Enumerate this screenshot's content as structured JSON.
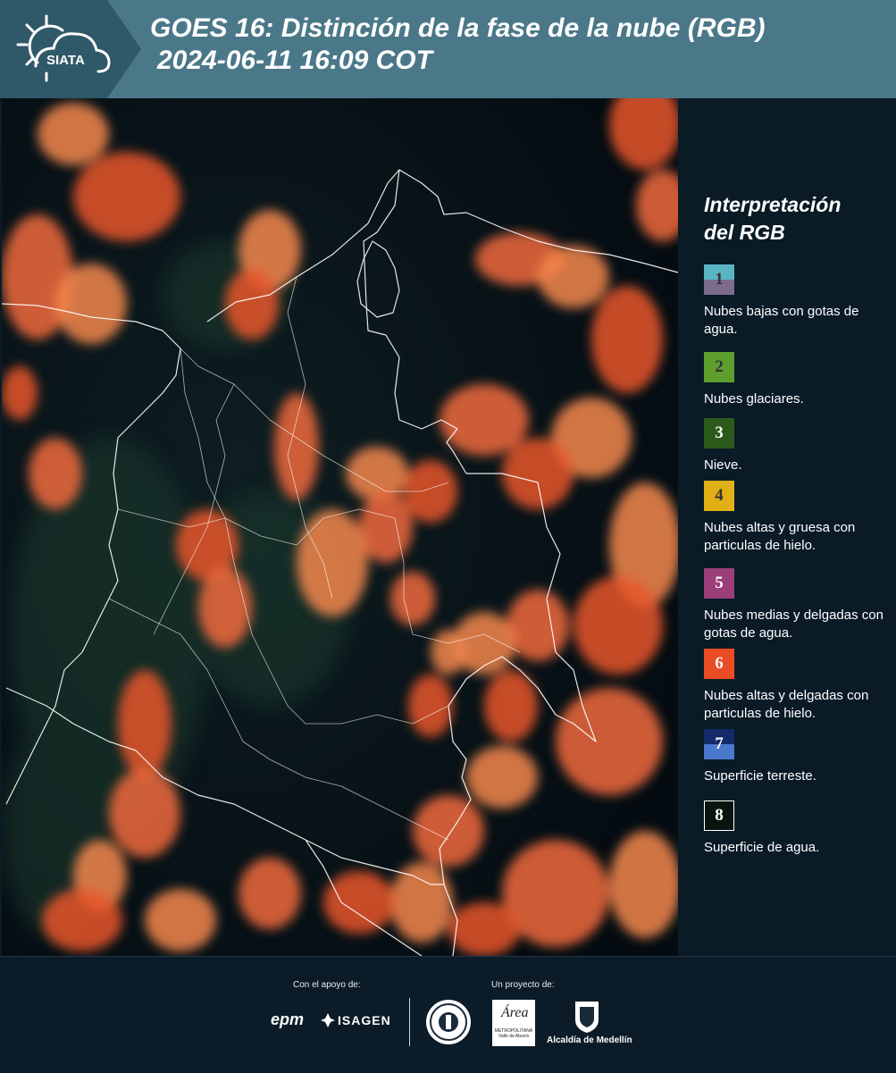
{
  "header": {
    "logo_text": "SIATA",
    "title_line1": "GOES 16: Distinción de la fase de la nube (RGB)",
    "title_line2": "2024-06-11 16:09 COT"
  },
  "legend": {
    "title_line1": "Interpretación",
    "title_line2": "del RGB",
    "items": [
      {
        "number": "1",
        "label": "Nubes bajas con gotas de agua.",
        "color_top": "#5ab4c4",
        "color_bottom": "#7c6c8c"
      },
      {
        "number": "2",
        "label": "Nubes glaciares.",
        "color_top": "#5e9e2c",
        "color_bottom": "#5e9e2c"
      },
      {
        "number": "3",
        "label": "Nieve.",
        "color_top": "#2c5a1a",
        "color_bottom": "#2c5a1a"
      },
      {
        "number": "4",
        "label": "Nubes altas y gruesa con particulas de hielo.",
        "color_top": "#e0b016",
        "color_bottom": "#e0b016"
      },
      {
        "number": "5",
        "label": "Nubes medias y delgadas con gotas de agua.",
        "color_top": "#9c3e78",
        "color_bottom": "#9c3e78"
      },
      {
        "number": "6",
        "label": "Nubes altas y delgadas con particulas de hielo.",
        "color_top": "#ea4c26",
        "color_bottom": "#ea4c26"
      },
      {
        "number": "7",
        "label": "Superficie terreste.",
        "color_top": "#142a6a",
        "color_bottom": "#4a78cc"
      },
      {
        "number": "8",
        "label": "Superficie de agua.",
        "color_top": "#0a140e",
        "color_bottom": "#0a140e"
      }
    ]
  },
  "footer": {
    "support_label": "Con el apoyo de:",
    "project_label": "Un proyecto de:",
    "sponsor_epm": "epm",
    "sponsor_isagen": "ISAGEN",
    "amva_word": "Área",
    "amva_sub": "METROPOLITANA Valle de Aburrá",
    "medellin": "Alcaldía de Medellín"
  },
  "colors": {
    "header_dark": "#2f5868",
    "header_light": "#4a7889",
    "background": "#0b1c28",
    "cloud_ice": "#f06a3c"
  }
}
